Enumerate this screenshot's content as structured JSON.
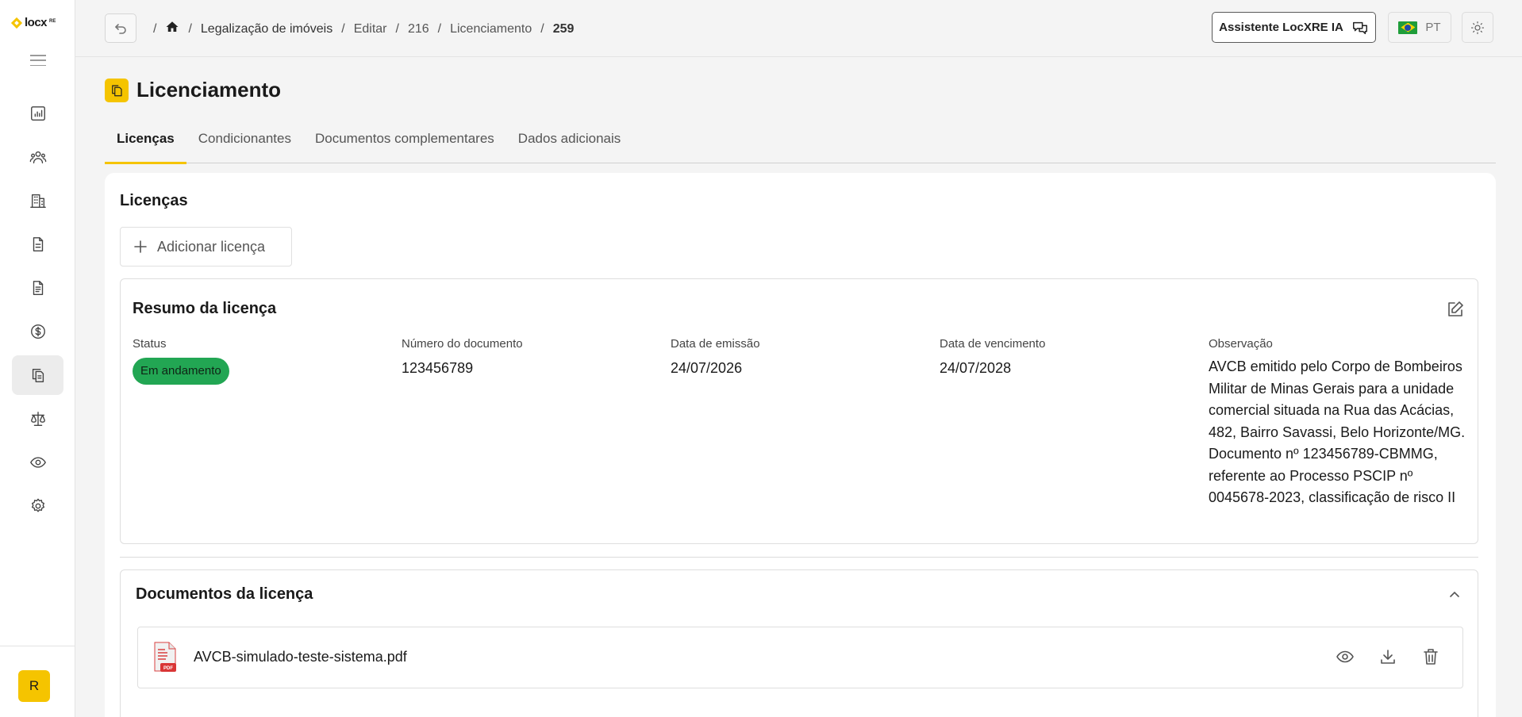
{
  "brand": {
    "name": "locx",
    "suffix": "RE"
  },
  "user": {
    "initial": "R"
  },
  "breadcrumb": {
    "items": [
      "Legalização de imóveis",
      "Editar",
      "216",
      "Licenciamento"
    ],
    "current": "259",
    "separator": "/"
  },
  "header": {
    "assistant_label": "Assistente LocXRE IA",
    "language": "PT"
  },
  "page": {
    "title": "Licenciamento"
  },
  "tabs": [
    {
      "label": "Licenças",
      "active": true
    },
    {
      "label": "Condicionantes",
      "active": false
    },
    {
      "label": "Documentos complementares",
      "active": false
    },
    {
      "label": "Dados adicionais",
      "active": false
    }
  ],
  "licenses": {
    "section_title": "Licenças",
    "add_label": "Adicionar licença",
    "summary": {
      "title": "Resumo da licença",
      "status_label": "Status",
      "status_value": "Em andamento",
      "status_color": "#22a653",
      "doc_number_label": "Número do documento",
      "doc_number_value": "123456789",
      "issue_label": "Data de emissão",
      "issue_value": "24/07/2026",
      "expiry_label": "Data de vencimento",
      "expiry_value": "24/07/2028",
      "obs_label": "Observação",
      "obs_value": "AVCB emitido pelo Corpo de Bombeiros Militar de Minas Gerais para a unidade comercial situada na Rua das Acácias, 482, Bairro Savassi, Belo Horizonte/MG. Documento nº 123456789-CBMMG, referente ao Processo PSCIP nº 0045678-2023, classificação de risco II"
    },
    "documents": {
      "title": "Documentos da licença",
      "files": [
        {
          "name": "AVCB-simulado-teste-sistema.pdf",
          "type": "PDF"
        }
      ]
    }
  },
  "colors": {
    "accent": "#f5c400",
    "status_green": "#22a653"
  }
}
